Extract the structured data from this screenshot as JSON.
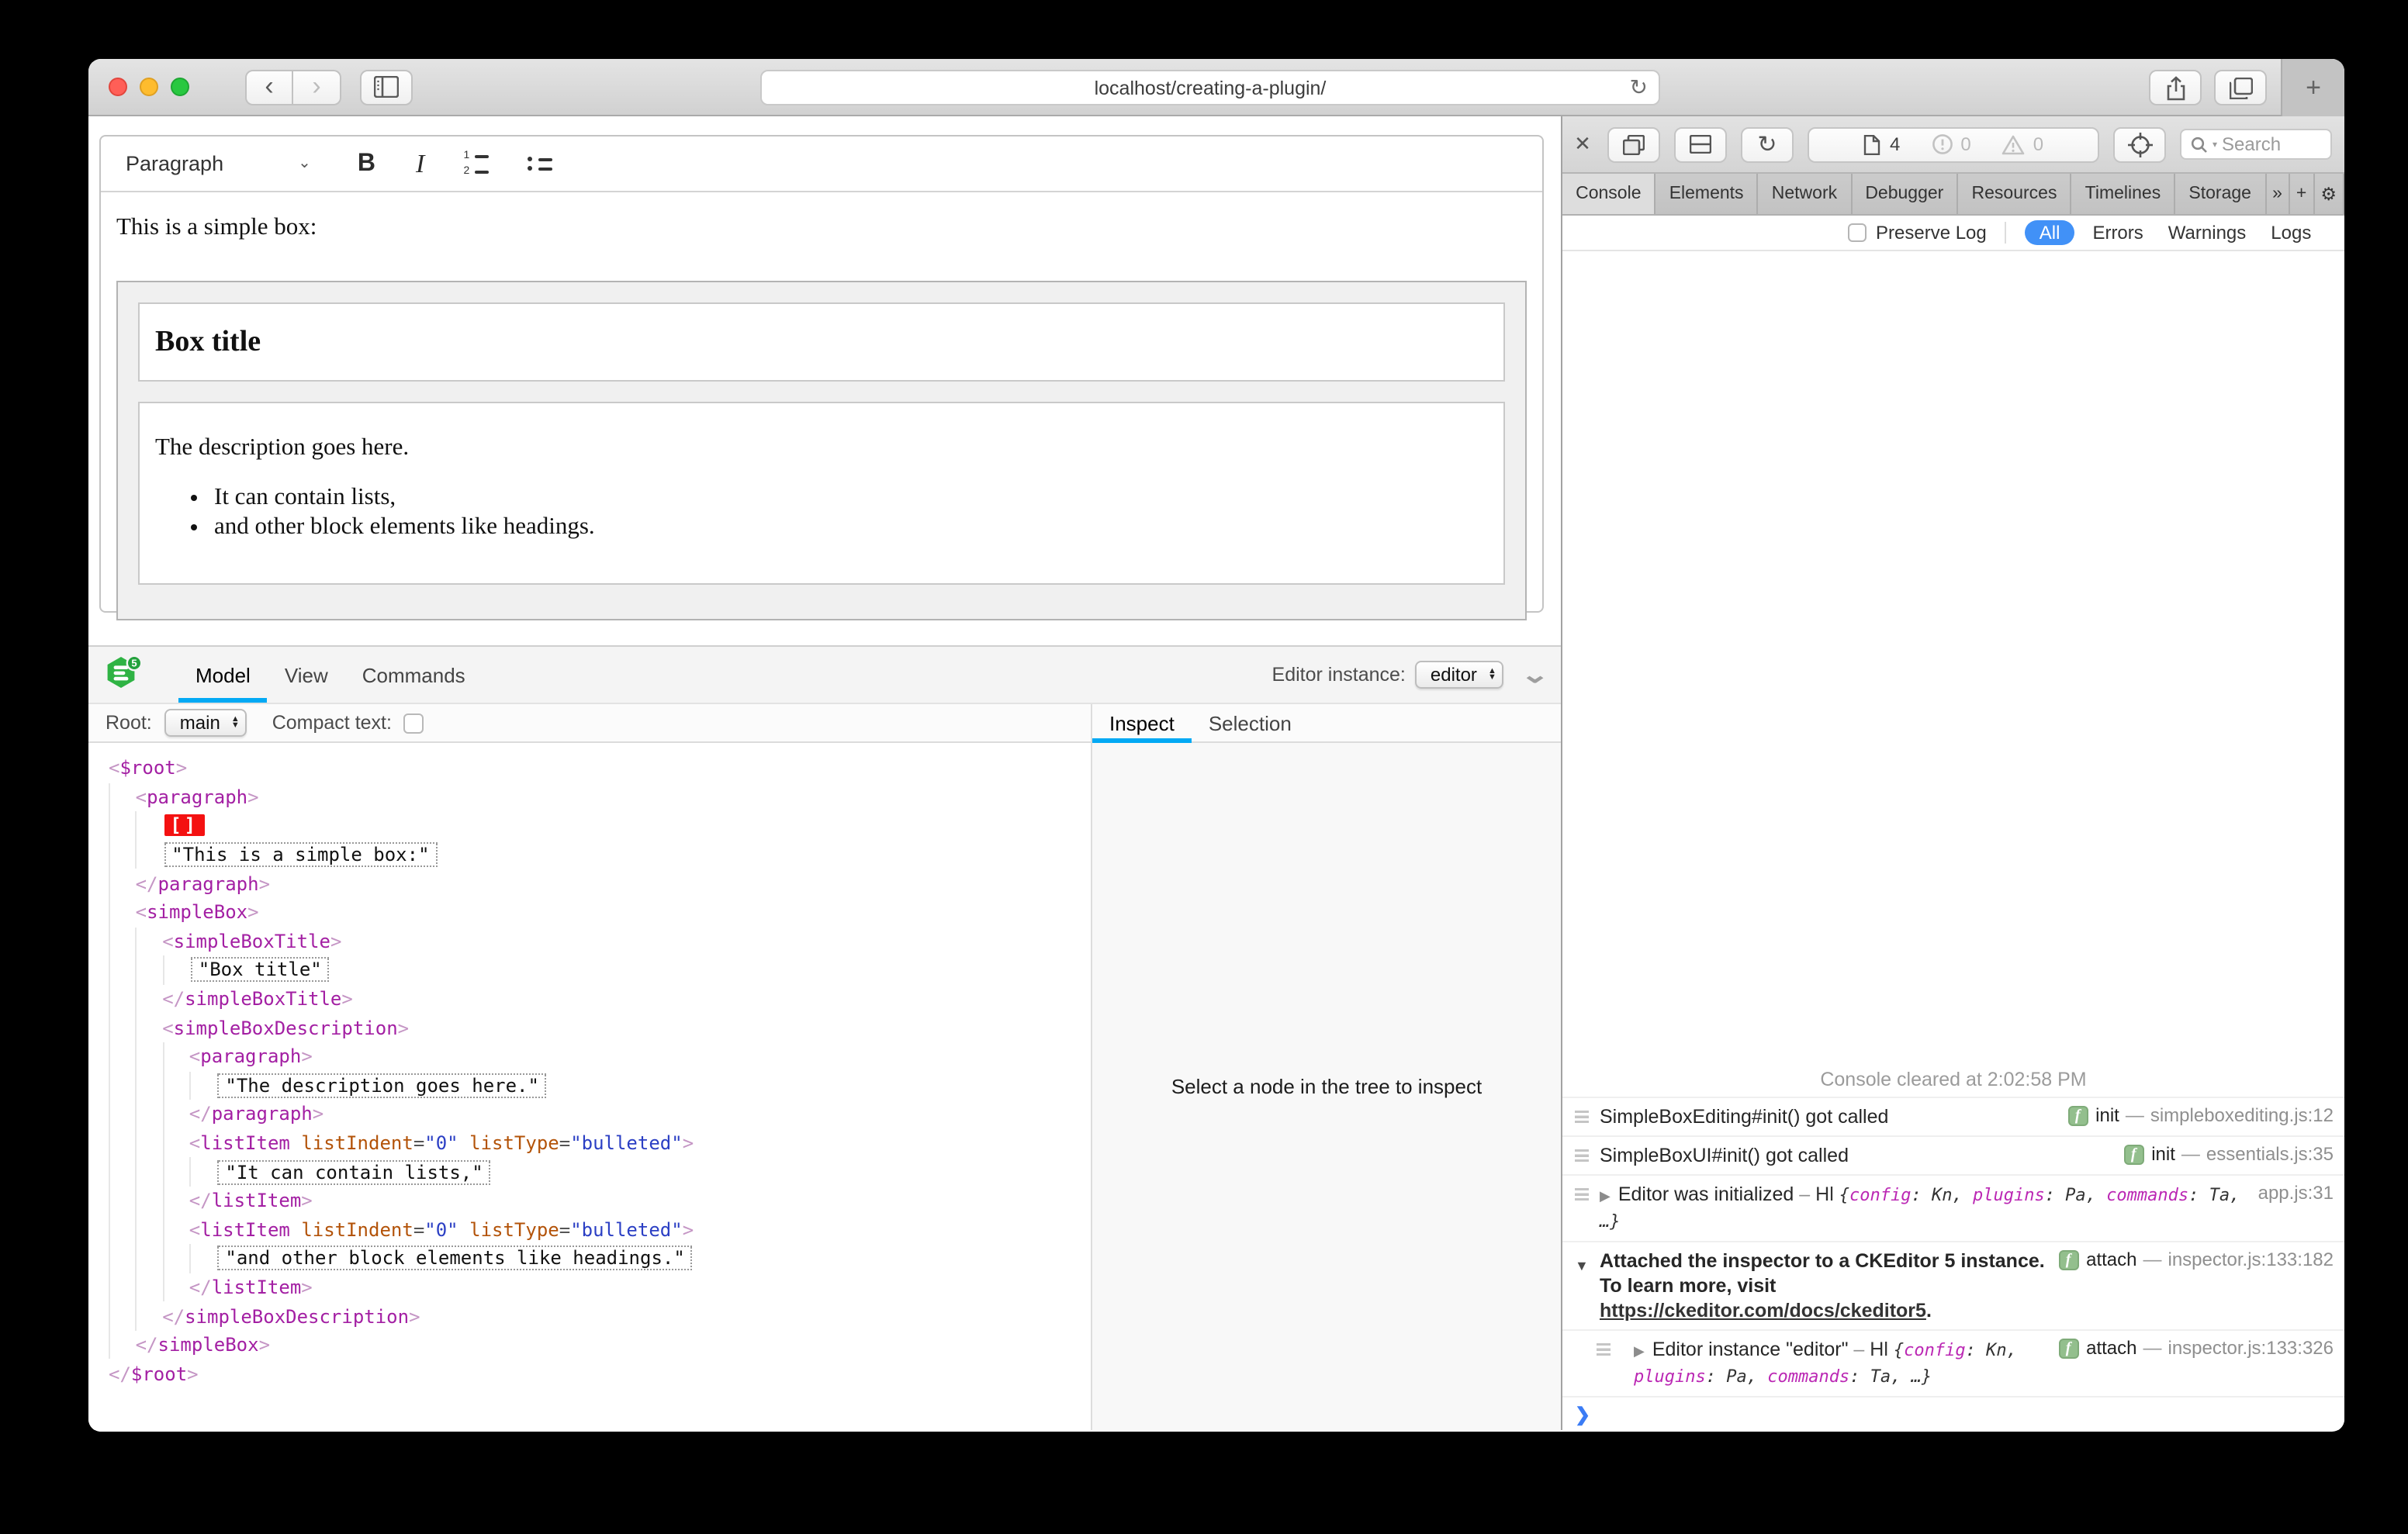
{
  "colors": {
    "accent_blue": "#03a9f4",
    "filter_active_blue": "#4191f7",
    "selection_marker_red": "#f41111",
    "badge_green": "#93bf8d",
    "traffic_red": "#ff5f57",
    "traffic_yellow": "#febc2e",
    "traffic_green": "#28c840"
  },
  "browser": {
    "url": "localhost/creating-a-plugin/",
    "new_tab_label": "+"
  },
  "editor": {
    "toolbar": {
      "heading_label": "Paragraph",
      "bold_label": "B",
      "italic_label": "I"
    },
    "content": {
      "intro": "This is a simple box:",
      "box_title": "Box title",
      "description": "The description goes here.",
      "list_items": [
        "It can contain lists,",
        "and other block elements like headings."
      ]
    }
  },
  "ck_inspector": {
    "logo_badge": "5",
    "tabs": [
      "Model",
      "View",
      "Commands"
    ],
    "active_tab": "Model",
    "instance_label": "Editor instance:",
    "instance_value": "editor",
    "root_label": "Root:",
    "root_value": "main",
    "compact_label": "Compact text:",
    "panel_tabs": [
      "Inspect",
      "Selection"
    ],
    "active_panel_tab": "Inspect",
    "panel_placeholder": "Select a node in the tree to inspect",
    "selection_marker": "[]",
    "tree": [
      {
        "indent": 0,
        "type": "open",
        "name": "$root"
      },
      {
        "indent": 1,
        "type": "open",
        "name": "paragraph"
      },
      {
        "indent": 2,
        "type": "selection"
      },
      {
        "indent": 2,
        "type": "text",
        "text": "This is a simple box:"
      },
      {
        "indent": 1,
        "type": "close",
        "name": "paragraph"
      },
      {
        "indent": 1,
        "type": "open",
        "name": "simpleBox"
      },
      {
        "indent": 2,
        "type": "open",
        "name": "simpleBoxTitle"
      },
      {
        "indent": 3,
        "type": "text",
        "text": "Box title"
      },
      {
        "indent": 2,
        "type": "close",
        "name": "simpleBoxTitle"
      },
      {
        "indent": 2,
        "type": "open",
        "name": "simpleBoxDescription"
      },
      {
        "indent": 3,
        "type": "open",
        "name": "paragraph"
      },
      {
        "indent": 4,
        "type": "text",
        "text": "The description goes here."
      },
      {
        "indent": 3,
        "type": "close",
        "name": "paragraph"
      },
      {
        "indent": 3,
        "type": "open",
        "name": "listItem",
        "attrs": [
          {
            "name": "listIndent",
            "value": "0"
          },
          {
            "name": "listType",
            "value": "bulleted"
          }
        ]
      },
      {
        "indent": 4,
        "type": "text",
        "text": "It can contain lists,"
      },
      {
        "indent": 3,
        "type": "close",
        "name": "listItem"
      },
      {
        "indent": 3,
        "type": "open",
        "name": "listItem",
        "attrs": [
          {
            "name": "listIndent",
            "value": "0"
          },
          {
            "name": "listType",
            "value": "bulleted"
          }
        ]
      },
      {
        "indent": 4,
        "type": "text",
        "text": "and other block elements like headings."
      },
      {
        "indent": 3,
        "type": "close",
        "name": "listItem"
      },
      {
        "indent": 2,
        "type": "close",
        "name": "simpleBoxDescription"
      },
      {
        "indent": 1,
        "type": "close",
        "name": "simpleBox"
      },
      {
        "indent": 0,
        "type": "close",
        "name": "$root"
      }
    ]
  },
  "devtools": {
    "toolbar": {
      "resources_count": "4",
      "errors_count": "0",
      "warnings_count": "0",
      "search_placeholder": "Search"
    },
    "tabs": [
      "Console",
      "Elements",
      "Network",
      "Debugger",
      "Resources",
      "Timelines",
      "Storage"
    ],
    "active_tab": "Console",
    "overflow_label": "»",
    "add_tab_label": "+",
    "filter": {
      "preserve_label": "Preserve Log",
      "scopes": [
        "All",
        "Errors",
        "Warnings",
        "Logs"
      ],
      "active_scope": "All"
    },
    "console": {
      "cleared_message": "Console cleared at 2:02:58 PM",
      "prompt_glyph": "❯",
      "rows": [
        {
          "kind": "log",
          "message": "SimpleBoxEditing#init() got called",
          "badge": "f",
          "badge_label": "init",
          "location": "simpleboxediting.js:12"
        },
        {
          "kind": "log",
          "message": "SimpleBoxUI#init() got called",
          "badge": "f",
          "badge_label": "init",
          "location": "essentials.js:35"
        },
        {
          "kind": "object",
          "arrow": "▶",
          "message": "Editor was initialized",
          "separator": "–",
          "class_name": "Hl",
          "preview_pairs": [
            {
              "key": "config",
              "value": "Kn"
            },
            {
              "key": "plugins",
              "value": "Pa"
            },
            {
              "key": "commands",
              "value": "Ta"
            }
          ],
          "preview_tail": ", …}",
          "location": "app.js:31"
        },
        {
          "kind": "group",
          "arrow": "▼",
          "message": "Attached the inspector to a CKEditor 5 instance. To learn more, visit ",
          "link": "https://ckeditor.com/docs/ckeditor5",
          "message_suffix": ".",
          "badge": "f",
          "badge_label": "attach",
          "location": "inspector.js:133:182"
        },
        {
          "kind": "object",
          "nested": true,
          "arrow": "▶",
          "message": "Editor instance \"editor\"",
          "separator": "–",
          "class_name": "Hl",
          "preview_pairs": [
            {
              "key": "config",
              "value": "Kn"
            },
            {
              "key": "plugins",
              "value": "Pa"
            },
            {
              "key": "commands",
              "value": "Ta"
            }
          ],
          "preview_tail": ", …}",
          "badge": "f",
          "badge_label": "attach",
          "location": "inspector.js:133:326"
        }
      ]
    }
  }
}
